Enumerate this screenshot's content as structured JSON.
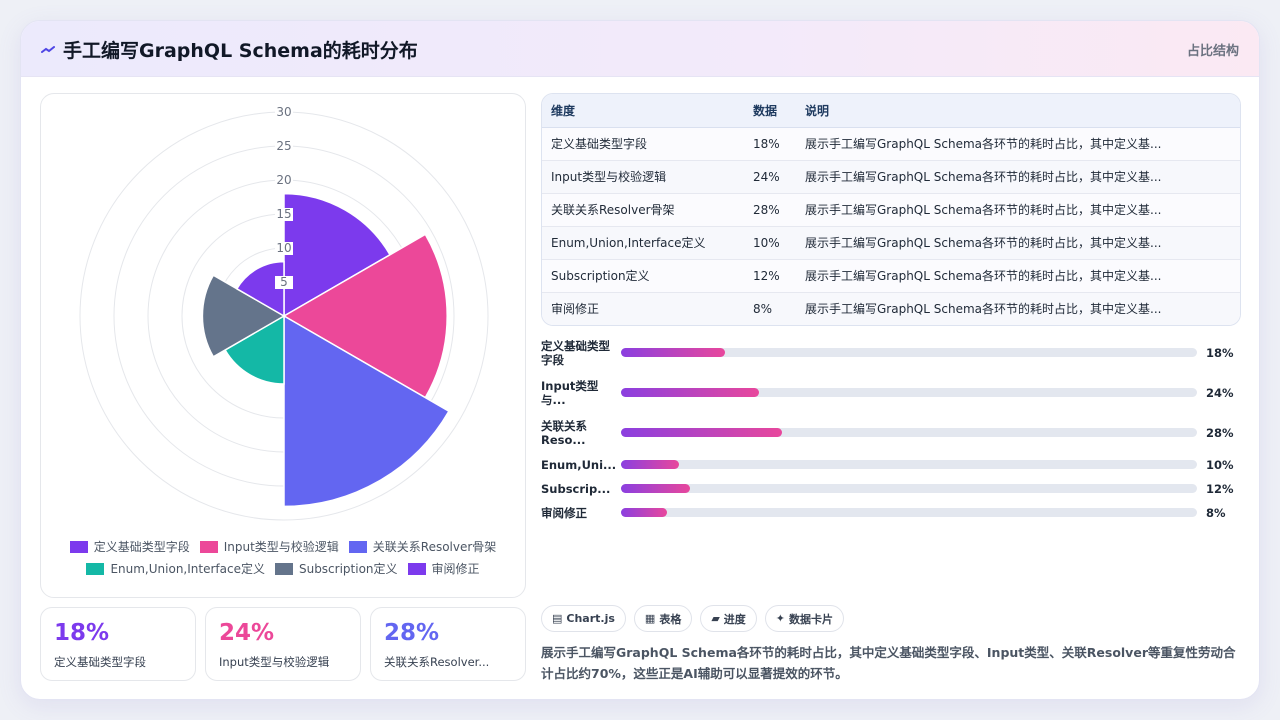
{
  "header": {
    "title": "手工编写GraphQL Schema的耗时分布",
    "tag": "占比结构"
  },
  "chart_data": {
    "type": "polarArea",
    "categories": [
      "定义基础类型字段",
      "Input类型与校验逻辑",
      "关联关系Resolver骨架",
      "Enum,Union,Interface定义",
      "Subscription定义",
      "审阅修正"
    ],
    "values": [
      18,
      24,
      28,
      10,
      12,
      8
    ],
    "colors": [
      "#7c3aed",
      "#ec4899",
      "#6366f1",
      "#14b8a6",
      "#64748b",
      "#7c3aed"
    ],
    "rlim": [
      0,
      30
    ],
    "ticks": [
      "5",
      "10",
      "15",
      "20",
      "25",
      "30"
    ],
    "legend": "bottom"
  },
  "stats": [
    {
      "num": "18%",
      "label": "定义基础类型字段",
      "color": "#7c3aed"
    },
    {
      "num": "24%",
      "label": "Input类型与校验逻辑",
      "color": "#ec4899"
    },
    {
      "num": "28%",
      "label": "关联关系Resolver...",
      "color": "#6366f1"
    }
  ],
  "table": {
    "headers": [
      "维度",
      "数据",
      "说明"
    ],
    "rows": [
      [
        "定义基础类型字段",
        "18%",
        "展示手工编写GraphQL Schema各环节的耗时占比，其中定义基..."
      ],
      [
        "Input类型与校验逻辑",
        "24%",
        "展示手工编写GraphQL Schema各环节的耗时占比，其中定义基..."
      ],
      [
        "关联关系Resolver骨架",
        "28%",
        "展示手工编写GraphQL Schema各环节的耗时占比，其中定义基..."
      ],
      [
        "Enum,Union,Interface定义",
        "10%",
        "展示手工编写GraphQL Schema各环节的耗时占比，其中定义基..."
      ],
      [
        "Subscription定义",
        "12%",
        "展示手工编写GraphQL Schema各环节的耗时占比，其中定义基..."
      ],
      [
        "审阅修正",
        "8%",
        "展示手工编写GraphQL Schema各环节的耗时占比，其中定义基..."
      ]
    ]
  },
  "progress": [
    {
      "label": "定义基础类型字段",
      "value": 18,
      "text": "18%"
    },
    {
      "label": "Input类型与...",
      "value": 24,
      "text": "24%"
    },
    {
      "label": "关联关系Reso...",
      "value": 28,
      "text": "28%"
    },
    {
      "label": "Enum,Uni...",
      "value": 10,
      "text": "10%"
    },
    {
      "label": "Subscrip...",
      "value": 12,
      "text": "12%"
    },
    {
      "label": "审阅修正",
      "value": 8,
      "text": "8%"
    }
  ],
  "chips": [
    {
      "icon": "▤",
      "label": "Chart.js"
    },
    {
      "icon": "▦",
      "label": "表格"
    },
    {
      "icon": "▰",
      "label": "进度"
    },
    {
      "icon": "✦",
      "label": "数据卡片"
    }
  ],
  "description": "展示手工编写GraphQL Schema各环节的耗时占比，其中定义基础类型字段、Input类型、关联Resolver等重复性劳动合计占比约70%，这些正是AI辅助可以显著提效的环节。"
}
